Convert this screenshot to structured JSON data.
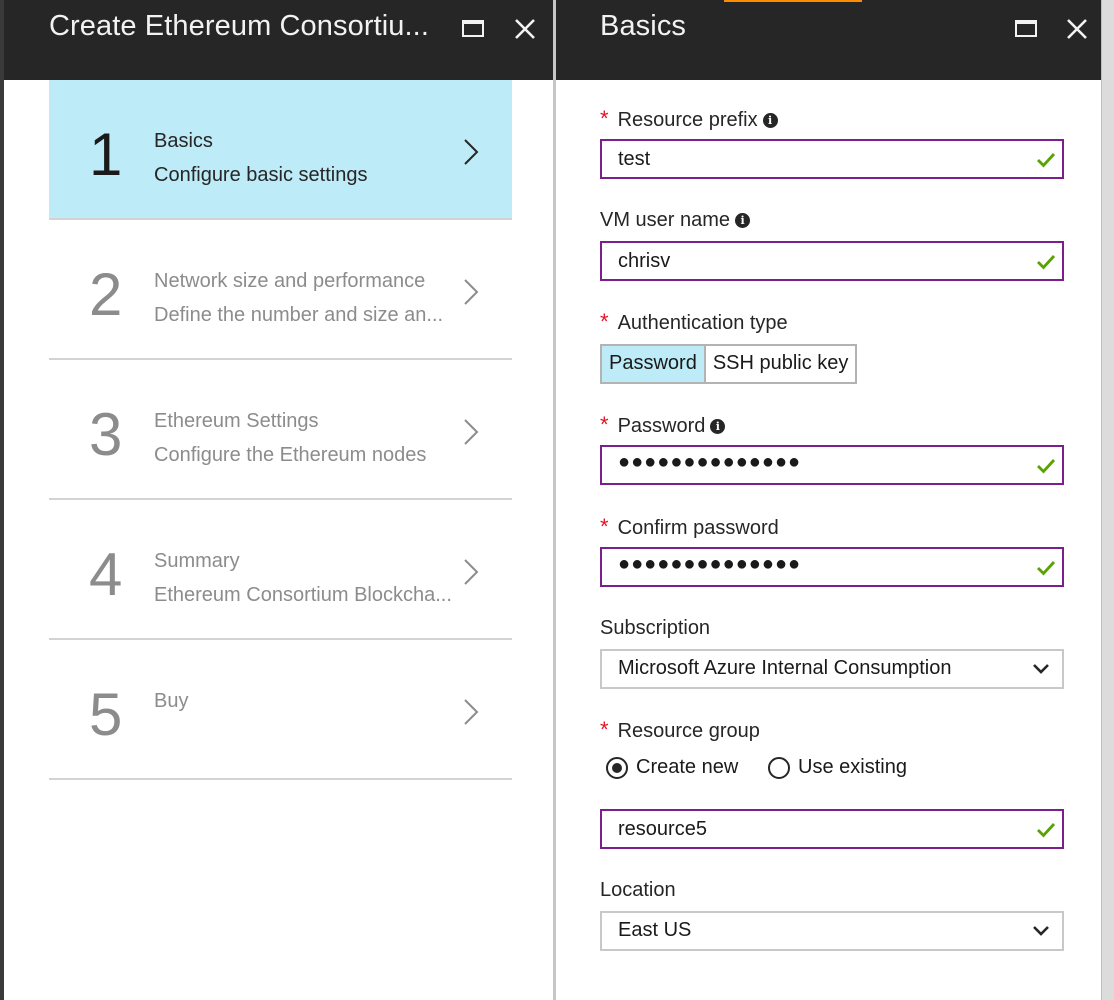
{
  "colors": {
    "header_bg": "#262626",
    "active_step": "#bdebf7",
    "input_border_valid": "#7a1f8c",
    "check": "#57a300",
    "required": "#e81123"
  },
  "left_blade": {
    "title": "Create Ethereum Consortiu...",
    "steps": [
      {
        "number": "1",
        "title": "Basics",
        "subtitle": "Configure basic settings",
        "active": true
      },
      {
        "number": "2",
        "title": "Network size and performance",
        "subtitle": "Define the number and size an...",
        "active": false
      },
      {
        "number": "3",
        "title": "Ethereum Settings",
        "subtitle": "Configure the Ethereum nodes",
        "active": false
      },
      {
        "number": "4",
        "title": "Summary",
        "subtitle": "Ethereum Consortium Blockcha...",
        "active": false
      },
      {
        "number": "5",
        "title": "Buy",
        "subtitle": "",
        "active": false
      }
    ]
  },
  "right_blade": {
    "title": "Basics",
    "fields": {
      "resource_prefix": {
        "label": "Resource prefix",
        "value": "test",
        "required": true
      },
      "vm_user_name": {
        "label": "VM user name",
        "value": "chrisv",
        "required": false
      },
      "authentication_type": {
        "label": "Authentication type",
        "options": [
          "Password",
          "SSH public key"
        ],
        "selected": "Password",
        "required": true
      },
      "password": {
        "label": "Password",
        "value": "●●●●●●●●●●●●●●",
        "required": true
      },
      "confirm_password": {
        "label": "Confirm password",
        "value": "●●●●●●●●●●●●●●",
        "required": true
      },
      "subscription": {
        "label": "Subscription",
        "value": "Microsoft Azure Internal Consumption"
      },
      "resource_group": {
        "label": "Resource group",
        "options": [
          "Create new",
          "Use existing"
        ],
        "selected": "Create new",
        "value": "resource5",
        "required": true
      },
      "location": {
        "label": "Location",
        "value": "East US"
      }
    }
  },
  "icons": {
    "maximize": "maximize-icon",
    "close": "close-icon",
    "chevron_right": "chevron-right-icon",
    "chevron_down": "chevron-down-icon",
    "info": "info-icon",
    "check": "checkmark-icon"
  }
}
